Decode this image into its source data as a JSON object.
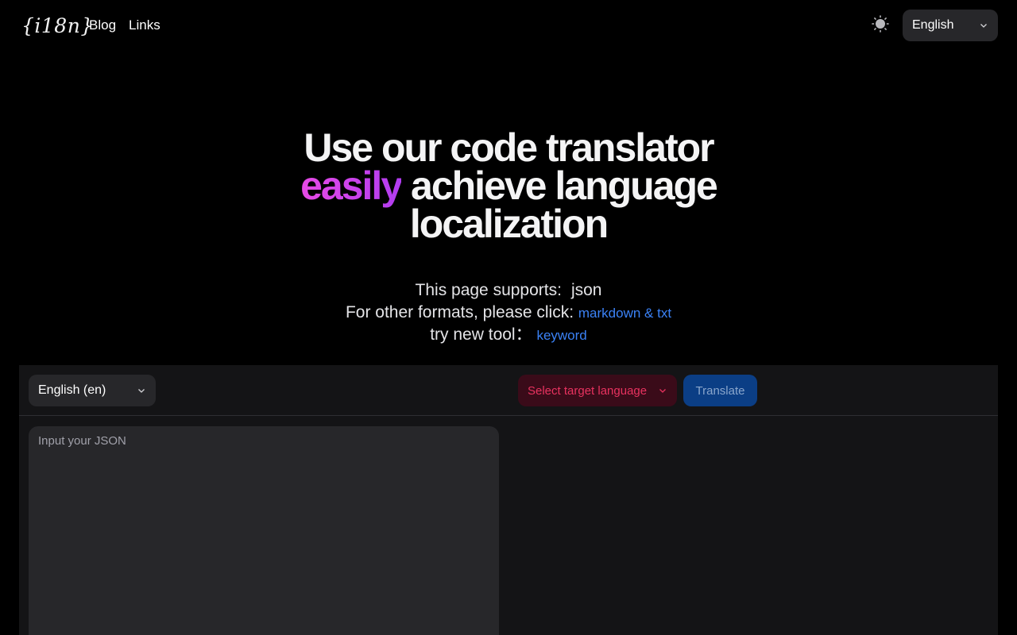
{
  "header": {
    "logo_text": "{i18n}",
    "nav": [
      {
        "label": "Blog"
      },
      {
        "label": "Links"
      }
    ],
    "theme_icon": "sun-icon",
    "language_select": {
      "value": "English"
    }
  },
  "hero": {
    "title_before": "Use our code translator ",
    "title_accent": "easily",
    "title_after": " achieve language localization",
    "accent_gradient": [
      "#e74ae6",
      "#b13cf0"
    ]
  },
  "support": {
    "line1_label": "This page supports:",
    "line1_value": "json",
    "line2_label": "For other formats, please click:",
    "line2_link": "markdown & txt",
    "line3_label": "try new tool：",
    "line3_link": "keyword",
    "link_color": "#3b82f6"
  },
  "translator": {
    "source_language": "English (en)",
    "target_language_placeholder": "Select target language",
    "translate_label": "Translate",
    "input_placeholder": "Input your JSON",
    "input_value": ""
  },
  "colors": {
    "background": "#000000",
    "panel": "#141416",
    "control": "#27272a",
    "target_select_bg": "#3a0b19",
    "target_select_text": "#e8325f",
    "translate_bg": "#0b3e85"
  }
}
